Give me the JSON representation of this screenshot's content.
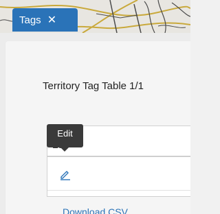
{
  "map": {
    "background_color": "#e8e6e1",
    "road_color": "#c9a93b",
    "line_color": "#4a4a4a"
  },
  "tab": {
    "label": "Tags",
    "close_glyph": "✕",
    "close_icon": "close-icon",
    "color": "#2a73b8"
  },
  "panel": {
    "title": "Territory Tag Table 1/1"
  },
  "table": {
    "header_label": "Edit",
    "edit_icon": "pencil-icon"
  },
  "tooltip": {
    "text": "Edit"
  },
  "footer": {
    "download_label": "Download CSV"
  },
  "colors": {
    "accent": "#2a73b8",
    "tooltip_bg": "#3a3a3a"
  }
}
